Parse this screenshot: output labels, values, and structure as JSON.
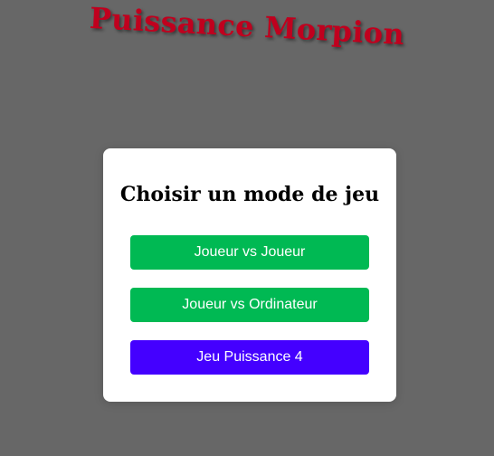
{
  "header": {
    "title": "Puissance Morpion"
  },
  "modal": {
    "title": "Choisir un mode de jeu",
    "buttons": [
      {
        "label": "Joueur vs Joueur",
        "color": "#00b953"
      },
      {
        "label": "Joueur vs Ordinateur",
        "color": "#00b953"
      },
      {
        "label": "Jeu Puissance 4",
        "color": "#4400ff"
      }
    ]
  },
  "colors": {
    "background": "#676767",
    "title": "#c0001e"
  }
}
